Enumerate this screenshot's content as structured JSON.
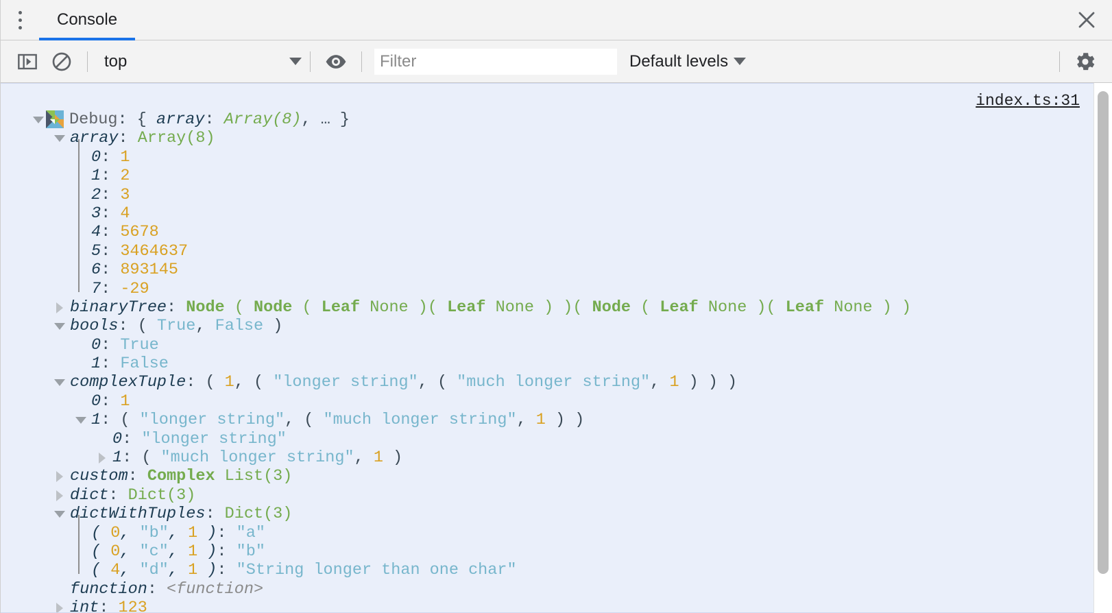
{
  "tabbar": {
    "menu_icon": "kebab-menu-icon",
    "tabs": [
      {
        "label": "Console",
        "active": true
      }
    ],
    "close_icon": "close-icon"
  },
  "toolbar": {
    "sidebar_toggle_icon": "console-sidebar-icon",
    "clear_icon": "clear-console-icon",
    "context_selected": "top",
    "context_caret_icon": "chevron-down-icon",
    "eye_icon": "live-expression-eye-icon",
    "filter_placeholder": "Filter",
    "filter_value": "",
    "levels_label": "Default levels",
    "levels_caret_icon": "chevron-down-icon",
    "settings_icon": "gear-icon"
  },
  "console": {
    "source_link": "index.ts:31",
    "logo_icon": "app-logo-icon",
    "accent_color": "#1a73e8",
    "message_bg": "#eaeffa",
    "rows": [
      {
        "indent": 0,
        "tri": "open",
        "logo": true,
        "parts": [
          {
            "t": "Debug",
            "c": "c-label"
          },
          {
            "t": ": ",
            "c": "c-punct"
          },
          {
            "t": "{ ",
            "c": "c-punct"
          },
          {
            "t": "array",
            "c": "c-key"
          },
          {
            "t": ": ",
            "c": "c-punct"
          },
          {
            "t": "Array(8)",
            "c": "c-gi"
          },
          {
            "t": ", … }",
            "c": "c-punct"
          }
        ]
      },
      {
        "indent": 1,
        "tri": "open",
        "parts": [
          {
            "t": "array",
            "c": "c-key"
          },
          {
            "t": ": ",
            "c": "c-punct"
          },
          {
            "t": "Array(8)",
            "c": "c-type"
          }
        ]
      },
      {
        "indent": 2,
        "tri": "none",
        "parts": [
          {
            "t": "0",
            "c": "c-idx"
          },
          {
            "t": ": ",
            "c": "c-punct"
          },
          {
            "t": "1",
            "c": "c-num"
          }
        ]
      },
      {
        "indent": 2,
        "tri": "none",
        "parts": [
          {
            "t": "1",
            "c": "c-idx"
          },
          {
            "t": ": ",
            "c": "c-punct"
          },
          {
            "t": "2",
            "c": "c-num"
          }
        ]
      },
      {
        "indent": 2,
        "tri": "none",
        "parts": [
          {
            "t": "2",
            "c": "c-idx"
          },
          {
            "t": ": ",
            "c": "c-punct"
          },
          {
            "t": "3",
            "c": "c-num"
          }
        ]
      },
      {
        "indent": 2,
        "tri": "none",
        "parts": [
          {
            "t": "3",
            "c": "c-idx"
          },
          {
            "t": ": ",
            "c": "c-punct"
          },
          {
            "t": "4",
            "c": "c-num"
          }
        ]
      },
      {
        "indent": 2,
        "tri": "none",
        "parts": [
          {
            "t": "4",
            "c": "c-idx"
          },
          {
            "t": ": ",
            "c": "c-punct"
          },
          {
            "t": "5678",
            "c": "c-num"
          }
        ]
      },
      {
        "indent": 2,
        "tri": "none",
        "parts": [
          {
            "t": "5",
            "c": "c-idx"
          },
          {
            "t": ": ",
            "c": "c-punct"
          },
          {
            "t": "3464637",
            "c": "c-num"
          }
        ]
      },
      {
        "indent": 2,
        "tri": "none",
        "parts": [
          {
            "t": "6",
            "c": "c-idx"
          },
          {
            "t": ": ",
            "c": "c-punct"
          },
          {
            "t": "893145",
            "c": "c-num"
          }
        ]
      },
      {
        "indent": 2,
        "tri": "none",
        "parts": [
          {
            "t": "7",
            "c": "c-idx"
          },
          {
            "t": ": ",
            "c": "c-punct"
          },
          {
            "t": "-29",
            "c": "c-num"
          }
        ]
      },
      {
        "indent": 1,
        "tri": "closed",
        "parts": [
          {
            "t": "binaryTree",
            "c": "c-key"
          },
          {
            "t": ": ",
            "c": "c-punct"
          },
          {
            "t": "Node",
            "c": "c-type-b"
          },
          {
            "t": " ( ",
            "c": "c-type"
          },
          {
            "t": "Node",
            "c": "c-type-b"
          },
          {
            "t": " ( ",
            "c": "c-type"
          },
          {
            "t": "Leaf",
            "c": "c-type-b"
          },
          {
            "t": " None )( ",
            "c": "c-type"
          },
          {
            "t": "Leaf",
            "c": "c-type-b"
          },
          {
            "t": " None ) )( ",
            "c": "c-type"
          },
          {
            "t": "Node",
            "c": "c-type-b"
          },
          {
            "t": " ( ",
            "c": "c-type"
          },
          {
            "t": "Leaf",
            "c": "c-type-b"
          },
          {
            "t": " None )( ",
            "c": "c-type"
          },
          {
            "t": "Leaf",
            "c": "c-type-b"
          },
          {
            "t": " None ) )",
            "c": "c-type"
          }
        ]
      },
      {
        "indent": 1,
        "tri": "open",
        "parts": [
          {
            "t": "bools",
            "c": "c-key"
          },
          {
            "t": ": ",
            "c": "c-punct"
          },
          {
            "t": "( ",
            "c": "c-punct"
          },
          {
            "t": "True",
            "c": "c-bool"
          },
          {
            "t": ", ",
            "c": "c-punct"
          },
          {
            "t": "False",
            "c": "c-bool"
          },
          {
            "t": " )",
            "c": "c-punct"
          }
        ]
      },
      {
        "indent": 2,
        "tri": "none",
        "parts": [
          {
            "t": "0",
            "c": "c-idx"
          },
          {
            "t": ": ",
            "c": "c-punct"
          },
          {
            "t": "True",
            "c": "c-bool"
          }
        ]
      },
      {
        "indent": 2,
        "tri": "none",
        "parts": [
          {
            "t": "1",
            "c": "c-idx"
          },
          {
            "t": ": ",
            "c": "c-punct"
          },
          {
            "t": "False",
            "c": "c-bool"
          }
        ]
      },
      {
        "indent": 1,
        "tri": "open",
        "parts": [
          {
            "t": "complexTuple",
            "c": "c-key"
          },
          {
            "t": ": ",
            "c": "c-punct"
          },
          {
            "t": "( ",
            "c": "c-punct"
          },
          {
            "t": "1",
            "c": "c-num"
          },
          {
            "t": ", ( ",
            "c": "c-punct"
          },
          {
            "t": "\"longer string\"",
            "c": "c-str"
          },
          {
            "t": ", ( ",
            "c": "c-punct"
          },
          {
            "t": "\"much longer string\"",
            "c": "c-str"
          },
          {
            "t": ", ",
            "c": "c-punct"
          },
          {
            "t": "1",
            "c": "c-num"
          },
          {
            "t": " ) ) )",
            "c": "c-punct"
          }
        ]
      },
      {
        "indent": 2,
        "tri": "none",
        "parts": [
          {
            "t": "0",
            "c": "c-idx"
          },
          {
            "t": ": ",
            "c": "c-punct"
          },
          {
            "t": "1",
            "c": "c-num"
          }
        ]
      },
      {
        "indent": 2,
        "tri": "open",
        "parts": [
          {
            "t": "1",
            "c": "c-idx"
          },
          {
            "t": ": ",
            "c": "c-punct"
          },
          {
            "t": "( ",
            "c": "c-punct"
          },
          {
            "t": "\"longer string\"",
            "c": "c-str"
          },
          {
            "t": ", ( ",
            "c": "c-punct"
          },
          {
            "t": "\"much longer string\"",
            "c": "c-str"
          },
          {
            "t": ", ",
            "c": "c-punct"
          },
          {
            "t": "1",
            "c": "c-num"
          },
          {
            "t": " ) )",
            "c": "c-punct"
          }
        ]
      },
      {
        "indent": 3,
        "tri": "none",
        "parts": [
          {
            "t": "0",
            "c": "c-idx"
          },
          {
            "t": ": ",
            "c": "c-punct"
          },
          {
            "t": "\"longer string\"",
            "c": "c-str"
          }
        ]
      },
      {
        "indent": 3,
        "tri": "closed",
        "parts": [
          {
            "t": "1",
            "c": "c-idx"
          },
          {
            "t": ": ",
            "c": "c-punct"
          },
          {
            "t": "( ",
            "c": "c-punct"
          },
          {
            "t": "\"much longer string\"",
            "c": "c-str"
          },
          {
            "t": ", ",
            "c": "c-punct"
          },
          {
            "t": "1",
            "c": "c-num"
          },
          {
            "t": " )",
            "c": "c-punct"
          }
        ]
      },
      {
        "indent": 1,
        "tri": "closed",
        "parts": [
          {
            "t": "custom",
            "c": "c-key"
          },
          {
            "t": ": ",
            "c": "c-punct"
          },
          {
            "t": "Complex",
            "c": "c-type-b"
          },
          {
            "t": " List(3)",
            "c": "c-type"
          }
        ]
      },
      {
        "indent": 1,
        "tri": "closed",
        "parts": [
          {
            "t": "dict",
            "c": "c-key"
          },
          {
            "t": ": ",
            "c": "c-punct"
          },
          {
            "t": "Dict(3)",
            "c": "c-type"
          }
        ]
      },
      {
        "indent": 1,
        "tri": "open",
        "parts": [
          {
            "t": "dictWithTuples",
            "c": "c-key"
          },
          {
            "t": ": ",
            "c": "c-punct"
          },
          {
            "t": "Dict(3)",
            "c": "c-type"
          }
        ]
      },
      {
        "indent": 2,
        "tri": "none",
        "parts": [
          {
            "t": "( ",
            "c": "c-idx"
          },
          {
            "t": "0",
            "c": "c-num"
          },
          {
            "t": ", ",
            "c": "c-idx"
          },
          {
            "t": "\"b\"",
            "c": "c-str"
          },
          {
            "t": ", ",
            "c": "c-idx"
          },
          {
            "t": "1",
            "c": "c-num"
          },
          {
            "t": " )",
            "c": "c-idx"
          },
          {
            "t": ": ",
            "c": "c-punct"
          },
          {
            "t": "\"a\"",
            "c": "c-str"
          }
        ]
      },
      {
        "indent": 2,
        "tri": "none",
        "parts": [
          {
            "t": "( ",
            "c": "c-idx"
          },
          {
            "t": "0",
            "c": "c-num"
          },
          {
            "t": ", ",
            "c": "c-idx"
          },
          {
            "t": "\"c\"",
            "c": "c-str"
          },
          {
            "t": ", ",
            "c": "c-idx"
          },
          {
            "t": "1",
            "c": "c-num"
          },
          {
            "t": " )",
            "c": "c-idx"
          },
          {
            "t": ": ",
            "c": "c-punct"
          },
          {
            "t": "\"b\"",
            "c": "c-str"
          }
        ]
      },
      {
        "indent": 2,
        "tri": "none",
        "parts": [
          {
            "t": "( ",
            "c": "c-idx"
          },
          {
            "t": "4",
            "c": "c-num"
          },
          {
            "t": ", ",
            "c": "c-idx"
          },
          {
            "t": "\"d\"",
            "c": "c-str"
          },
          {
            "t": ", ",
            "c": "c-idx"
          },
          {
            "t": "1",
            "c": "c-num"
          },
          {
            "t": " )",
            "c": "c-idx"
          },
          {
            "t": ": ",
            "c": "c-punct"
          },
          {
            "t": "\"String longer than one char\"",
            "c": "c-str"
          }
        ]
      },
      {
        "indent": 1,
        "tri": "none",
        "parts": [
          {
            "t": "function",
            "c": "c-key"
          },
          {
            "t": ": ",
            "c": "c-punct"
          },
          {
            "t": "<function>",
            "c": "c-func"
          }
        ]
      },
      {
        "indent": 1,
        "tri": "closed",
        "parts": [
          {
            "t": "int",
            "c": "c-key"
          },
          {
            "t": ": ",
            "c": "c-punct"
          },
          {
            "t": "123",
            "c": "c-num"
          }
        ]
      }
    ],
    "guides": [
      {
        "after_row": 1,
        "span_rows": 8,
        "indent": 2
      },
      {
        "after_row": 21,
        "span_rows": 3,
        "indent": 2
      }
    ]
  }
}
